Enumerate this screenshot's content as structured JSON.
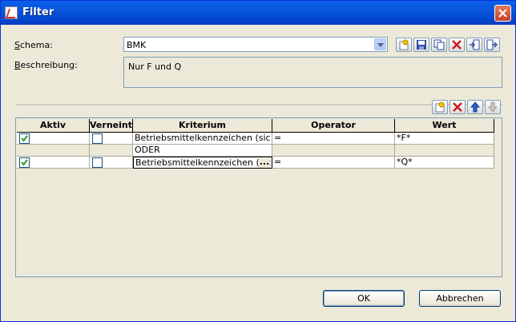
{
  "window": {
    "title": "Filter"
  },
  "schema": {
    "label_u": "S",
    "label_rest": "chema:",
    "value": "BMK"
  },
  "beschreibung": {
    "label_u": "B",
    "label_rest": "eschreibung:",
    "value": "Nur F und Q"
  },
  "toolbar_icons": [
    "new-icon",
    "save-icon",
    "copy-icon",
    "delete-icon",
    "import-icon",
    "export-icon"
  ],
  "grid_toolbar_icons": [
    "new-row-icon",
    "delete-row-icon",
    "move-up-icon",
    "move-down-icon"
  ],
  "columns": [
    "Aktiv",
    "Verneint",
    "Kriterium",
    "Operator",
    "Wert"
  ],
  "rows": [
    {
      "aktiv": true,
      "verneint": false,
      "kriterium": "Betriebsmittelkennzeichen (sic…",
      "operator": "=",
      "wert": "*F*"
    },
    {
      "separator": true,
      "kriterium": "ODER"
    },
    {
      "aktiv": true,
      "verneint": false,
      "kriterium": "Betriebsmittelkennzeichen (sic…",
      "operator": "=",
      "wert": "*Q*",
      "selected": true
    }
  ],
  "buttons": {
    "ok": "OK",
    "cancel": "Abbrechen"
  },
  "ellipsis": "..."
}
